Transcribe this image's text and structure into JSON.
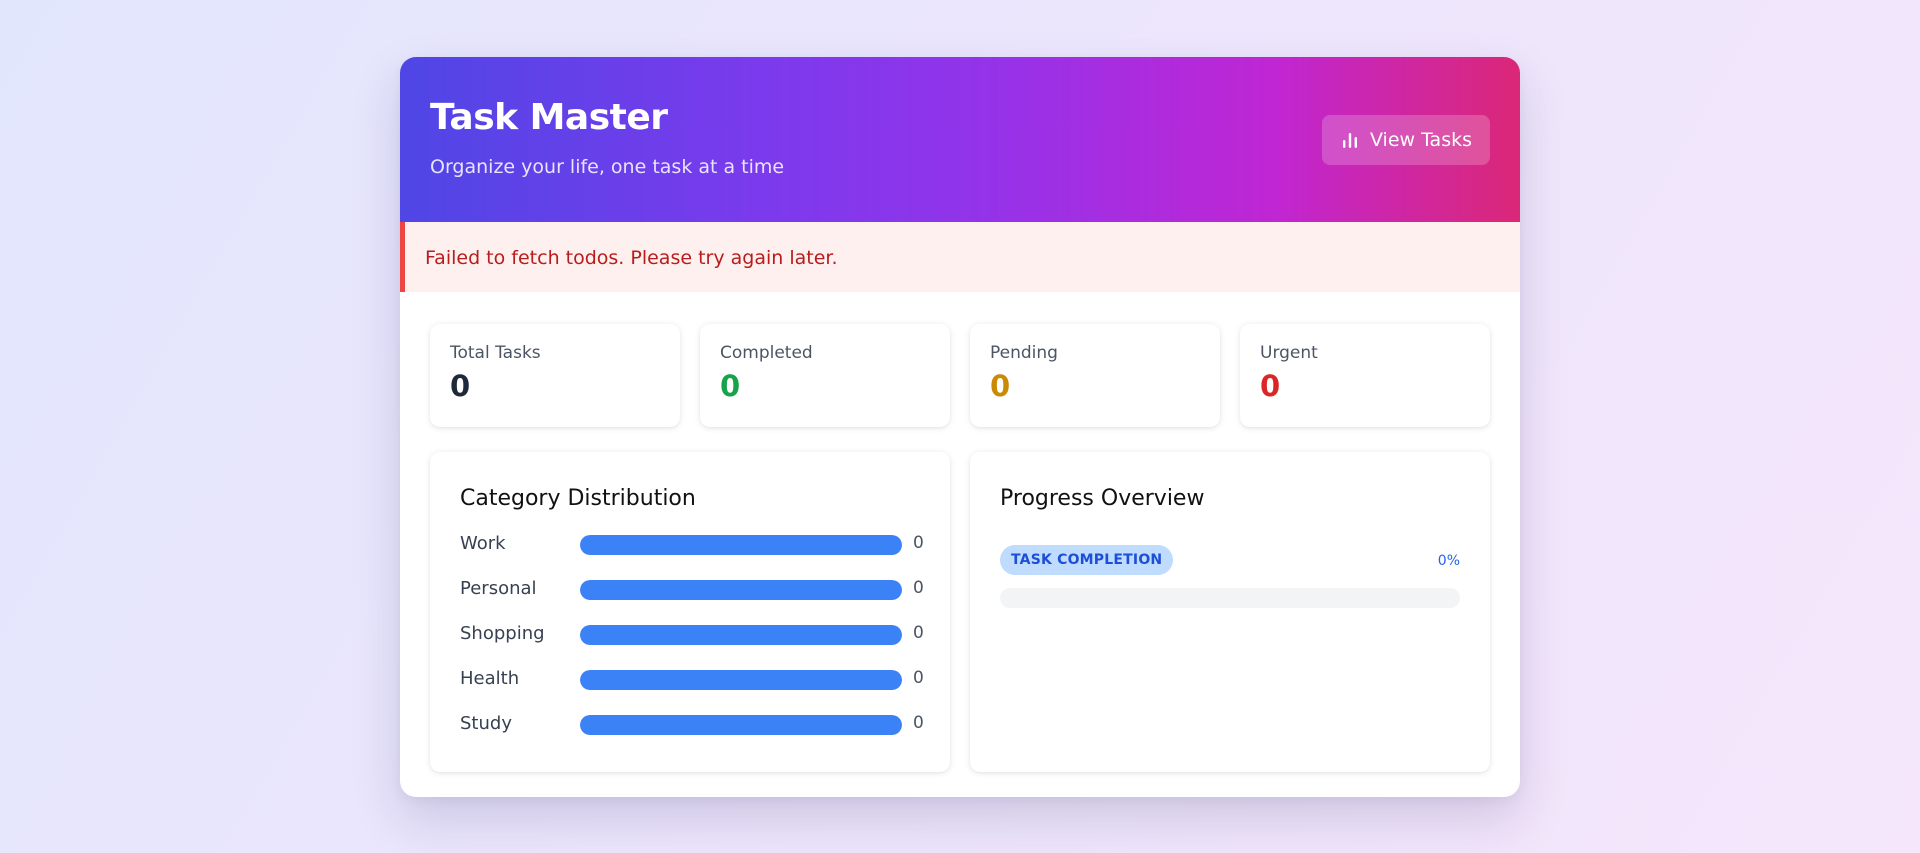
{
  "header": {
    "title": "Task Master",
    "subtitle": "Organize your life, one task at a time",
    "view_button": {
      "label": "View Tasks",
      "icon": "bar-chart-icon"
    }
  },
  "error": {
    "message": "Failed to fetch todos. Please try again later."
  },
  "stats": [
    {
      "label": "Total Tasks",
      "value": "0",
      "color": "#1e293b"
    },
    {
      "label": "Completed",
      "value": "0",
      "color": "#16a34a"
    },
    {
      "label": "Pending",
      "value": "0",
      "color": "#ca8a04"
    },
    {
      "label": "Urgent",
      "value": "0",
      "color": "#dc2626"
    }
  ],
  "category_distribution": {
    "title": "Category Distribution",
    "bar_color": "#3b82f6",
    "items": [
      {
        "label": "Work",
        "count": "0",
        "fill": 1
      },
      {
        "label": "Personal",
        "count": "0",
        "fill": 1
      },
      {
        "label": "Shopping",
        "count": "0",
        "fill": 1
      },
      {
        "label": "Health",
        "count": "0",
        "fill": 1
      },
      {
        "label": "Study",
        "count": "0",
        "fill": 1
      }
    ]
  },
  "progress": {
    "title": "Progress Overview",
    "badge": "TASK COMPLETION",
    "percent_text": "0%",
    "fraction": 0
  }
}
